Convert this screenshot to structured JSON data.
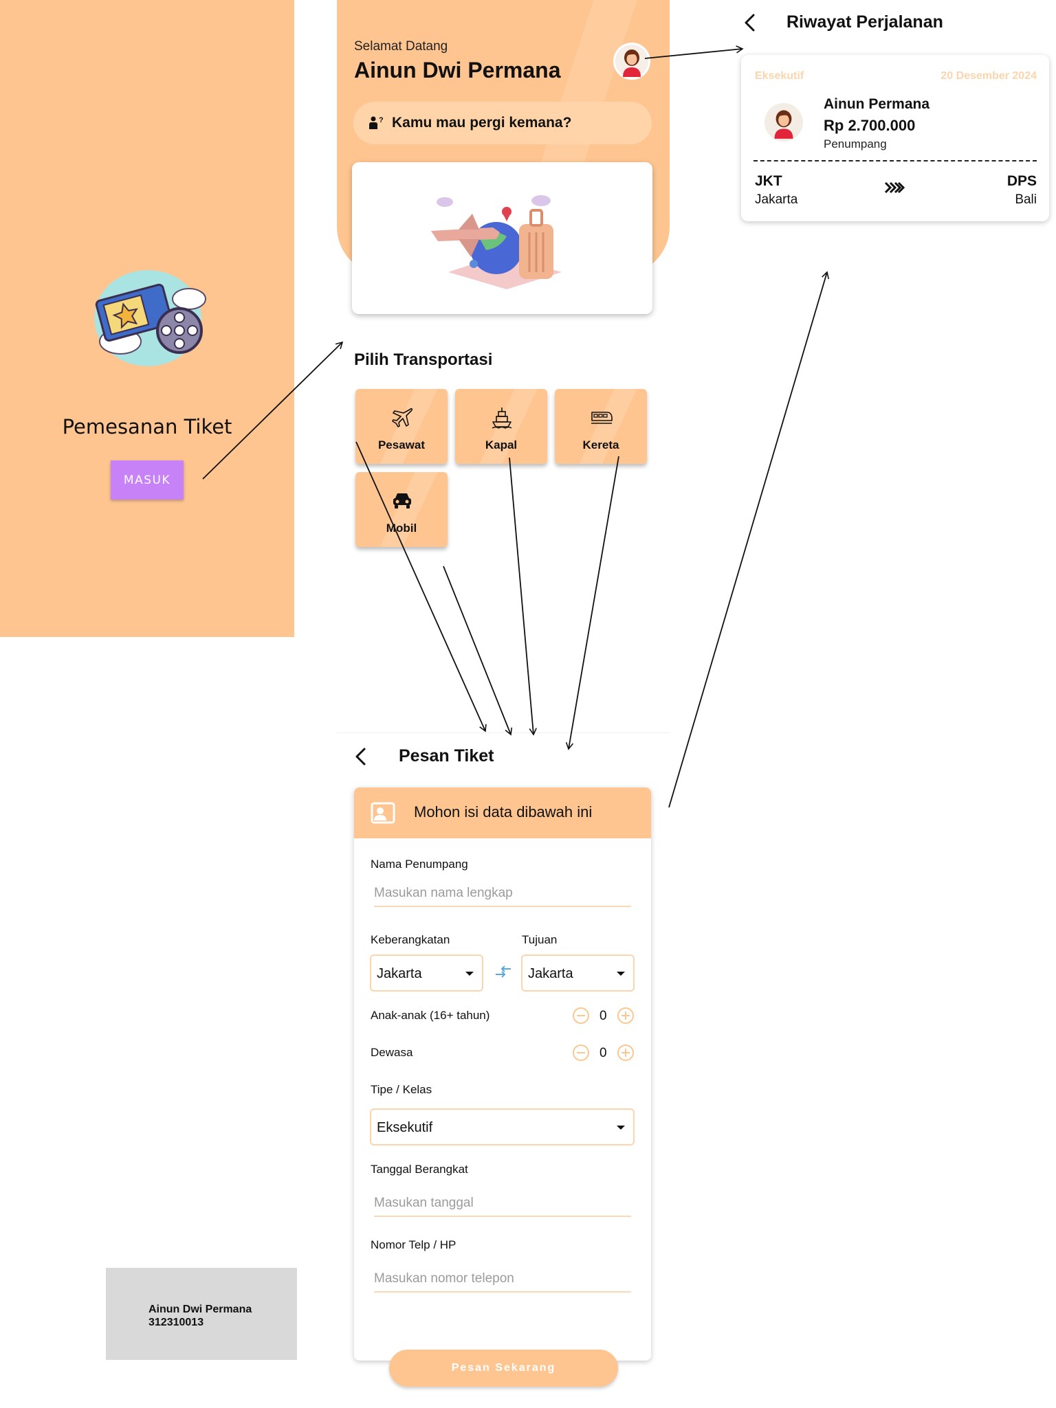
{
  "login": {
    "title": "Pemesanan Tiket",
    "button_label": "MASUK",
    "illustration_icon": "ticket-film-reel-icon"
  },
  "home": {
    "greeting": "Selamat Datang",
    "user_name": "Ainun Dwi Permana",
    "search_text": "Kamu mau pergi kemana?",
    "section_title": "Pilih Transportasi",
    "transport": [
      {
        "label": "Pesawat",
        "icon": "airplane-icon"
      },
      {
        "label": "Kapal",
        "icon": "ship-icon"
      },
      {
        "label": "Kereta",
        "icon": "train-icon"
      },
      {
        "label": "Mobil",
        "icon": "car-icon"
      }
    ],
    "banner_icon": "travel-globe-luggage-icon"
  },
  "history": {
    "title": "Riwayat Perjalanan",
    "card": {
      "class": "Eksekutif",
      "date": "20 Desember 2024",
      "passenger_name": "Ainun Permana",
      "price": "Rp 2.700.000",
      "passenger_type": "Penumpang",
      "from_code": "JKT",
      "from_city": "Jakarta",
      "to_code": "DPS",
      "to_city": "Bali"
    }
  },
  "order": {
    "title": "Pesan Tiket",
    "panel_header": "Mohon isi data dibawah ini",
    "name_label": "Nama Penumpang",
    "name_placeholder": "Masukan nama lengkap",
    "departure_label": "Keberangkatan",
    "departure_value": "Jakarta",
    "destination_label": "Tujuan",
    "destination_value": "Jakarta",
    "children_label": "Anak-anak (16+ tahun)",
    "children_count": "0",
    "adult_label": "Dewasa",
    "adult_count": "0",
    "class_label": "Tipe / Kelas",
    "class_value": "Eksekutif",
    "date_label": "Tanggal Berangkat",
    "date_placeholder": "Masukan tanggal",
    "phone_label": "Nomor Telp / HP",
    "phone_placeholder": "Masukan nomor telepon",
    "submit_label": "Pesan Sekarang"
  },
  "author": {
    "name": "Ainun Dwi Permana",
    "id": "312310013"
  },
  "colors": {
    "peach": "#fec590",
    "purple_button": "#c782f7",
    "muted_peach_text": "#fcd5ad",
    "swap_blue": "#5aa7e0"
  }
}
